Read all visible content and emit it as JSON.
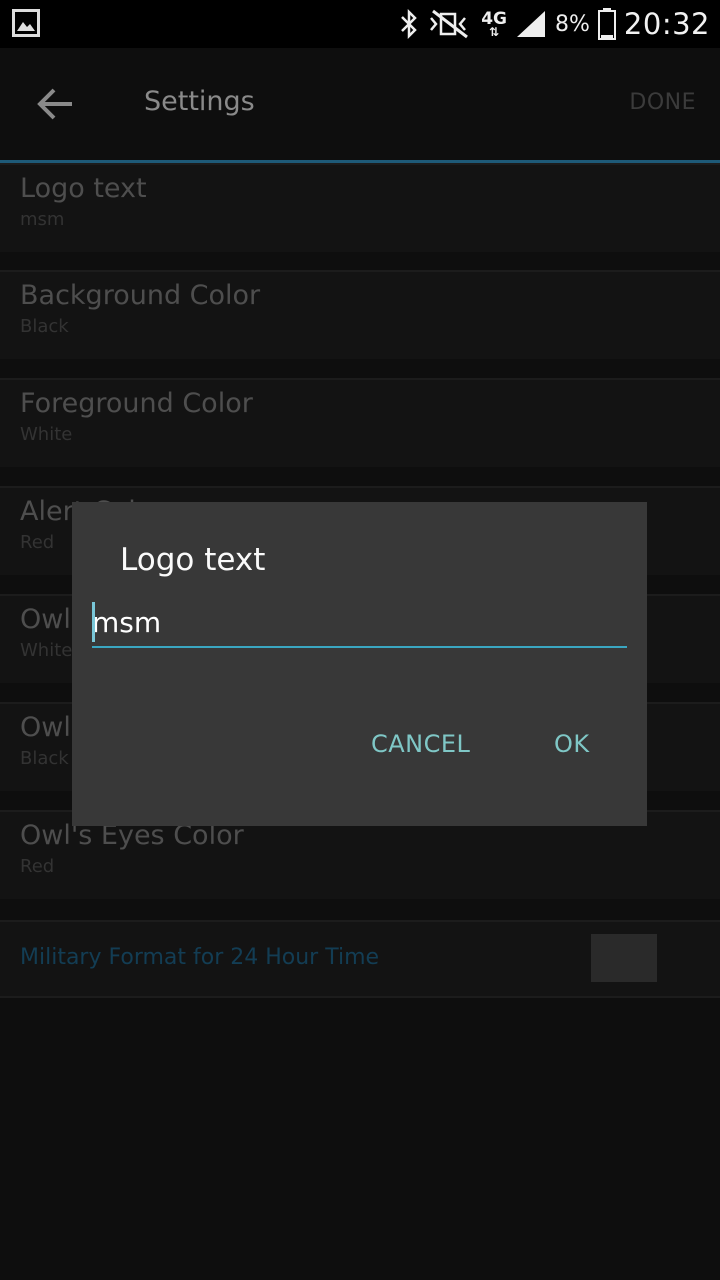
{
  "status_bar": {
    "battery_percent": "8%",
    "time": "20:32",
    "network": "4G",
    "icons": [
      "gallery-icon",
      "bluetooth-icon",
      "mute-vibrate-icon",
      "signal-icon",
      "battery-icon"
    ]
  },
  "action_bar": {
    "title": "Settings",
    "done_label": "DONE"
  },
  "preferences": [
    {
      "title": "Logo text",
      "summary": "msm"
    },
    {
      "title": "Background Color",
      "summary": "Black"
    },
    {
      "title": "Foreground Color",
      "summary": "White"
    },
    {
      "title": "Alert Color",
      "summary": "Red"
    },
    {
      "title": "Owl's Color",
      "summary": "White"
    },
    {
      "title": "Owl's Color",
      "summary": "Black"
    },
    {
      "title": "Owl's Eyes Color",
      "summary": "Red"
    }
  ],
  "toggle": {
    "title": "Military Format for 24 Hour Time"
  },
  "dialog": {
    "title": "Logo text",
    "input_value": "msm",
    "cancel_label": "CANCEL",
    "ok_label": "OK"
  },
  "colors": {
    "accent": "#3aa6c1",
    "button_text": "#7fc7c6",
    "dialog_bg": "#383838"
  }
}
